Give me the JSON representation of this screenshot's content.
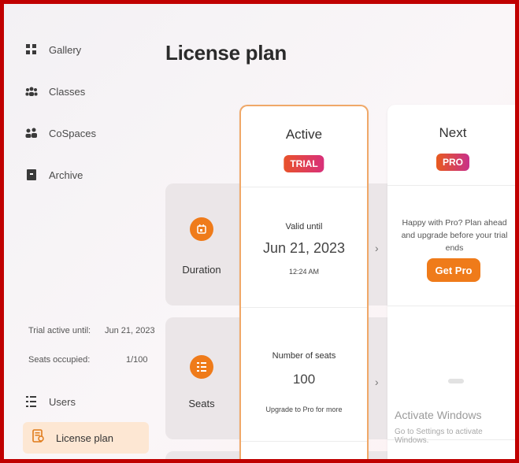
{
  "sidebar": {
    "items": [
      {
        "label": "Gallery",
        "icon": "grid-icon"
      },
      {
        "label": "Classes",
        "icon": "group-icon"
      },
      {
        "label": "CoSpaces",
        "icon": "people-icon"
      },
      {
        "label": "Archive",
        "icon": "archive-icon"
      }
    ],
    "trial_label": "Trial active until:",
    "trial_value": "Jun 21, 2023",
    "seats_label": "Seats occupied:",
    "seats_value": "1/100",
    "users_label": "Users",
    "license_label": "License plan"
  },
  "main": {
    "title": "License plan",
    "active": {
      "heading": "Active",
      "badge": "TRIAL"
    },
    "next": {
      "heading": "Next",
      "badge": "PRO"
    },
    "duration": {
      "label": "Duration",
      "valid_until_label": "Valid until",
      "date": "Jun 21, 2023",
      "time": "12:24 AM",
      "next_text": "Happy with Pro? Plan ahead and upgrade before your trial ends",
      "get_pro": "Get Pro"
    },
    "seats": {
      "label": "Seats",
      "number_label": "Number of seats",
      "number": "100",
      "upgrade_text": "Upgrade to Pro for more"
    },
    "chevron": "›",
    "watermark_title": "Activate Windows",
    "watermark_sub": "Go to Settings to activate Windows."
  },
  "colors": {
    "frame": "#c00000",
    "accent": "#ef7b1a",
    "active_border": "#f0a868"
  }
}
